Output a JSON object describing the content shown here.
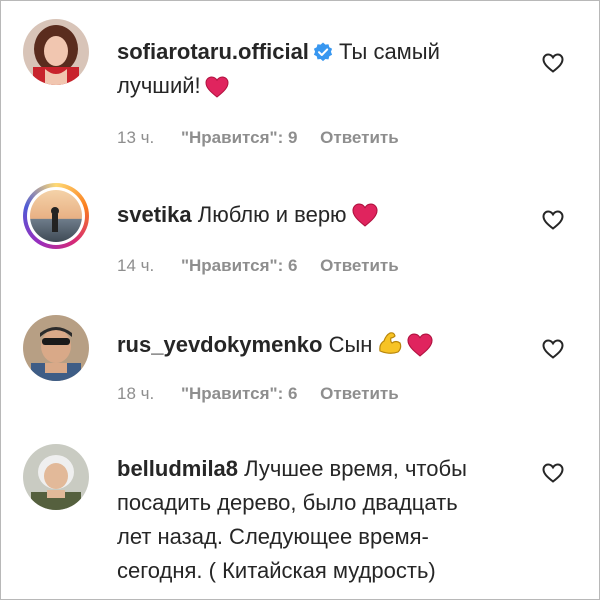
{
  "comments": [
    {
      "username": "sofiarotaru.official",
      "verified": true,
      "text_line1": "Ты самый",
      "text_line2": "лучший!",
      "time": "13 ч.",
      "likes": "\"Нравится\": 9",
      "reply": "Ответить",
      "emoji": [
        "red-heart"
      ]
    },
    {
      "username": "svetika",
      "text": "Люблю и верю",
      "time": "14 ч.",
      "likes": "\"Нравится\": 6",
      "reply": "Ответить",
      "emoji": [
        "red-heart"
      ]
    },
    {
      "username": "rus_yevdokymenko",
      "text": "Сын",
      "time": "18 ч.",
      "likes": "\"Нравится\": 6",
      "reply": "Ответить",
      "emoji": [
        "flexed-biceps",
        "red-heart"
      ]
    },
    {
      "username": "belludmila8",
      "text_line1": "Лучшее время, чтобы",
      "text_line2": "посадить дерево, было двадцать",
      "text_line3": "лет назад. Следующее время-",
      "text_line4": "сегодня. ( Китайская мудрость)"
    }
  ],
  "icons": {
    "verified": "verified-badge-icon",
    "like": "heart-outline-icon"
  },
  "colors": {
    "text": "#262626",
    "meta": "#8e8e8e",
    "verified": "#3897f0",
    "heart": "#e0245e"
  }
}
